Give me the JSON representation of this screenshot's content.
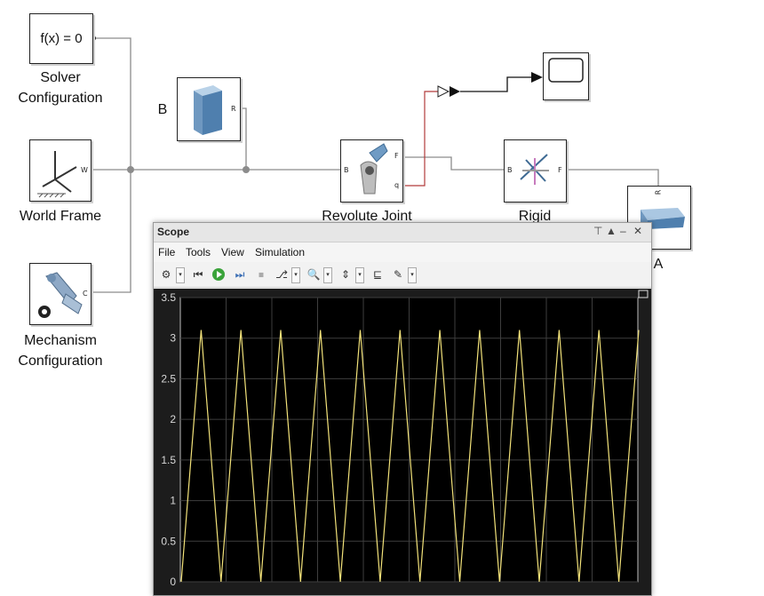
{
  "diagram": {
    "solver": {
      "expr": "f(x) = 0",
      "label_l1": "Solver",
      "label_l2": "Configuration"
    },
    "world_frame": {
      "label": "World Frame",
      "port": "W"
    },
    "mechanism": {
      "label_l1": "Mechanism",
      "label_l2": "Configuration",
      "port": "C"
    },
    "body_b": {
      "name": "B",
      "port": "R"
    },
    "revolute": {
      "label": "Revolute Joint",
      "port_b": "B",
      "port_f": "F",
      "port_q": "q"
    },
    "rigid": {
      "label": "Rigid",
      "port_b": "B",
      "port_f": "F"
    },
    "body_a": {
      "label": "A",
      "port": "R"
    }
  },
  "scope": {
    "title": "Scope",
    "controls": [
      "⊤",
      "▲",
      "–",
      "✕"
    ],
    "menus": [
      "File",
      "Tools",
      "View",
      "Simulation"
    ]
  },
  "chart_data": {
    "type": "line",
    "ylim": [
      0,
      3.5
    ],
    "yticks": [
      "0",
      "0.5",
      "1",
      "1.5",
      "2",
      "2.5",
      "3",
      "3.5"
    ],
    "grid": true,
    "background": "#000000",
    "line_color": "#f2e27a",
    "series": [
      {
        "peaks_y": 3.1,
        "troughs_y": 0.0,
        "peak_count": 12,
        "values": [
          0,
          3.1,
          0,
          3.1,
          0,
          3.1,
          0,
          3.1,
          0,
          3.1,
          0,
          3.1,
          0,
          3.1,
          0,
          3.1,
          0,
          3.1,
          0,
          3.1,
          0,
          3.1,
          0,
          3.1
        ]
      }
    ]
  }
}
